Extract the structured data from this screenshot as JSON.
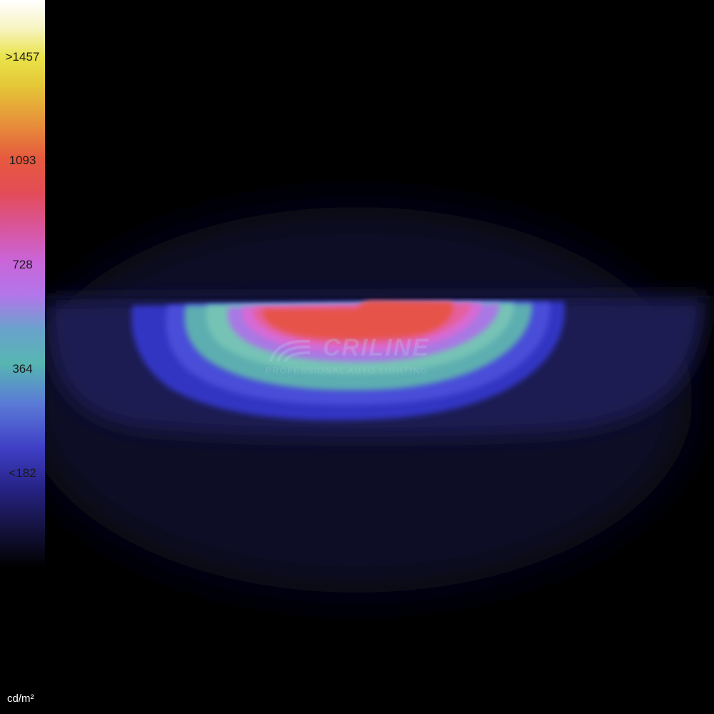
{
  "colorbar": {
    "ticks": [
      ">1457",
      "1093",
      "728",
      "364",
      "<182"
    ],
    "unit": "cd/m²"
  },
  "watermark": {
    "brand": "CRILINE",
    "tagline": "PROFESSIONAL AUTO LIGHTING"
  },
  "colors": {
    "background": "#000000",
    "outer_haze": "#181a3c",
    "blue": "#2f31c8",
    "indigo": "#4649e0",
    "teal": "#5fb0b0",
    "light_teal": "#79c9b8",
    "violet": "#b06fe3",
    "magenta": "#d86ad6",
    "pink": "#e65d98",
    "red": "#e6534a"
  }
}
